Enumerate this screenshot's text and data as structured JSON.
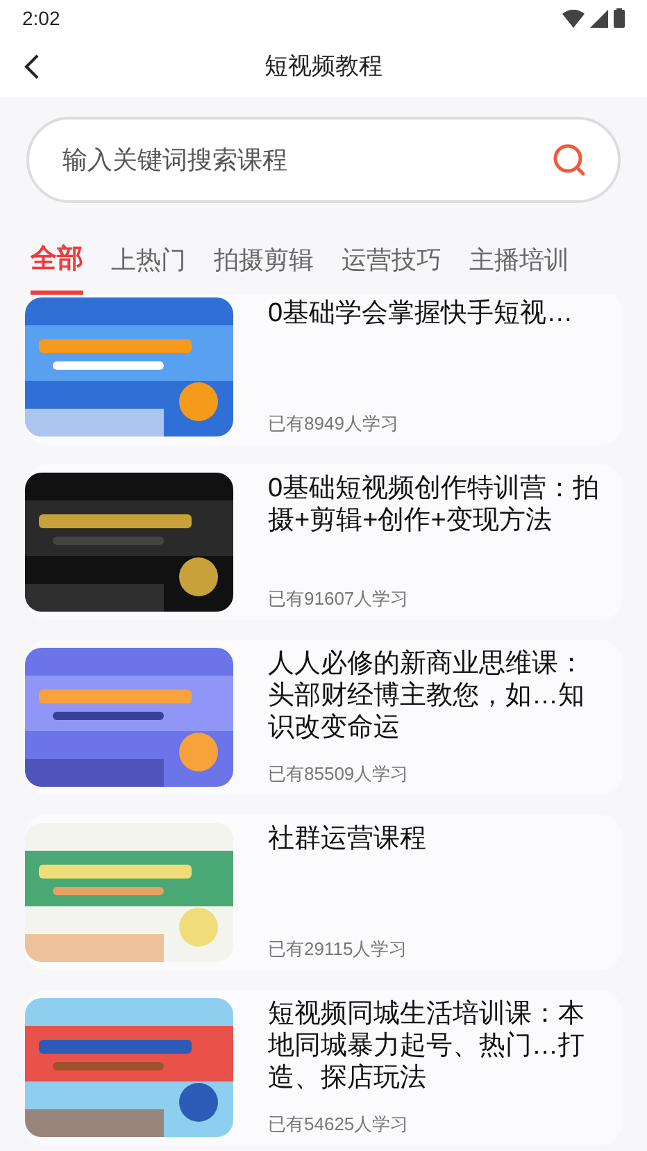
{
  "status_bar": {
    "time": "2:02"
  },
  "header": {
    "title": "短视频教程"
  },
  "search": {
    "placeholder": "输入关键词搜索课程"
  },
  "tabs": [
    {
      "label": "全部",
      "selected": true
    },
    {
      "label": "上热门",
      "selected": false
    },
    {
      "label": "拍摄剪辑",
      "selected": false
    },
    {
      "label": "运营技巧",
      "selected": false
    },
    {
      "label": "主播培训",
      "selected": false
    }
  ],
  "courses": [
    {
      "title": "0基础学会掌握快手短视…",
      "learners": "已有8949人学习"
    },
    {
      "title": "0基础短视频创作特训营：拍摄+剪辑+创作+变现方法",
      "learners": "已有91607人学习"
    },
    {
      "title": "人人必修的新商业思维课：头部财经博主教您，如…知识改变命运",
      "learners": "已有85509人学习"
    },
    {
      "title": "社群运营课程",
      "learners": "已有29115人学习"
    },
    {
      "title": "短视频同城生活培训课：本地同城暴力起号、热门…打造、探店玩法",
      "learners": "已有54625人学习"
    }
  ]
}
